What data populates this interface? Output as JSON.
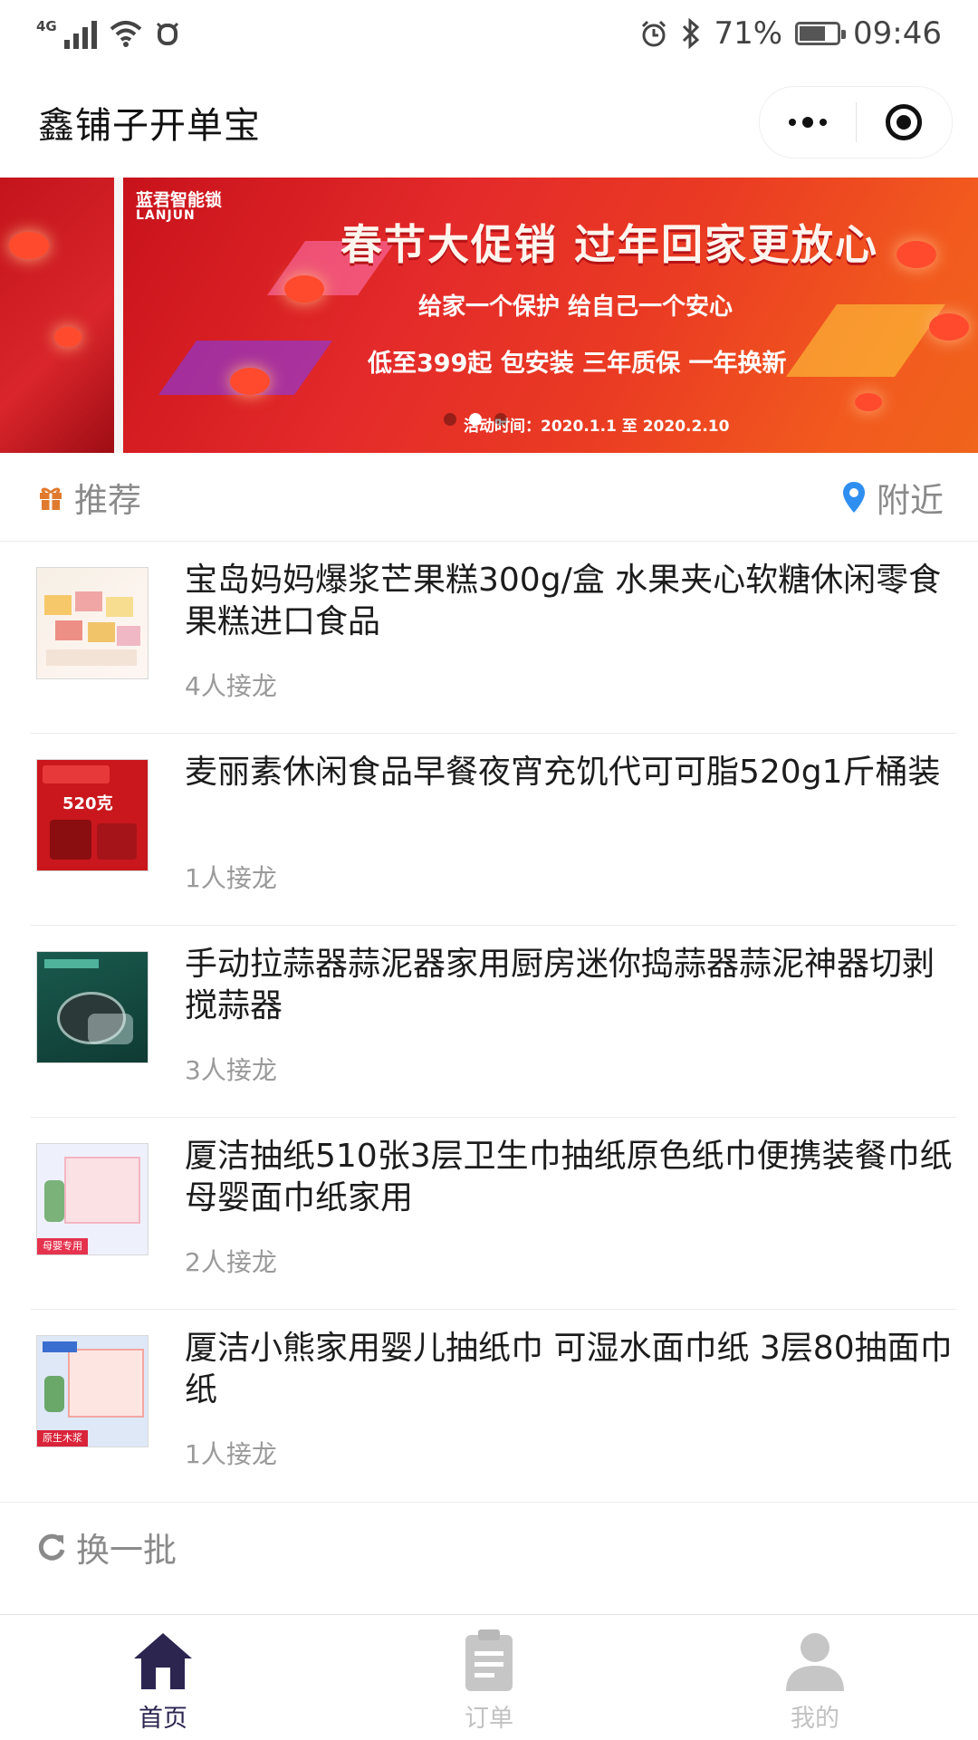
{
  "status_bar": {
    "network": "4G",
    "battery": "71%",
    "battery_level": 0.71,
    "time": "09:46",
    "icons": [
      "signal-icon",
      "wifi-icon",
      "notification-icon",
      "alarm-icon",
      "bluetooth-icon",
      "battery-icon"
    ]
  },
  "nav": {
    "title": "鑫铺子开单宝",
    "more_icon": "more-dots-icon",
    "close_icon": "target-circle-icon"
  },
  "banner": {
    "brand_cn": "蓝君智能锁",
    "brand_en": "LANJUN",
    "title": "春节大促销  过年回家更放心",
    "subtitle": "给家一个保护   给自己一个安心",
    "offer": "低至399起  包安装  三年质保  一年换新",
    "date": "活动时间：2020.1.1 至 2020.2.10",
    "slide_count": 3,
    "active_slide": 2
  },
  "section": {
    "recommend_label": "推荐",
    "recommend_icon": "gift-icon",
    "nearby_label": "附近",
    "nearby_icon": "location-pin-icon",
    "accent_orange": "#e07a2e",
    "accent_blue": "#2f8ff0"
  },
  "products": [
    {
      "title": "宝岛妈妈爆浆芒果糕300g/盒 水果夹心软糖休闲零食果糕进口食品",
      "joined": "4人接龙"
    },
    {
      "title": "麦丽素休闲食品早餐夜宵充饥代可可脂520g1斤桶装",
      "joined": "1人接龙",
      "thumb_text": "520克"
    },
    {
      "title": "手动拉蒜器蒜泥器家用厨房迷你捣蒜器蒜泥神器切剥搅蒜器",
      "joined": "3人接龙"
    },
    {
      "title": "厦洁抽纸510张3层卫生巾抽纸原色纸巾便携装餐巾纸母婴面巾纸家用",
      "joined": "2人接龙",
      "thumb_text": "母婴专用"
    },
    {
      "title": "厦洁小熊家用婴儿抽纸巾 可湿水面巾纸 3层80抽面巾纸",
      "joined": "1人接龙",
      "thumb_text": "原生木浆"
    }
  ],
  "refresh": {
    "label": "换一批",
    "icon": "refresh-icon"
  },
  "tabs": [
    {
      "label": "首页",
      "icon": "home-icon",
      "active": true
    },
    {
      "label": "订单",
      "icon": "clipboard-icon",
      "active": false
    },
    {
      "label": "我的",
      "icon": "user-icon",
      "active": false
    }
  ],
  "colors": {
    "tab_active": "#2b2550",
    "tab_inactive": "#c2c2c2",
    "banner_red": "#e42a2a"
  }
}
